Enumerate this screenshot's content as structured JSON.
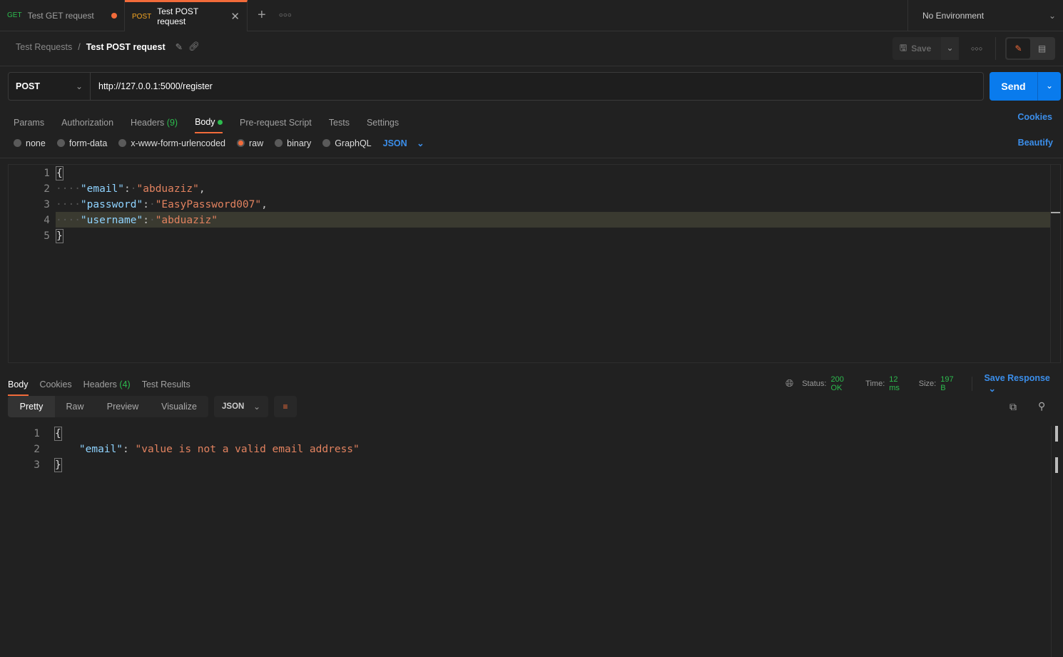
{
  "tabs": [
    {
      "method": "GET",
      "label": "Test GET request",
      "unsaved": true
    },
    {
      "method": "POST",
      "label": "Test POST request",
      "active": true
    }
  ],
  "environment": "No Environment",
  "breadcrumb": {
    "collection": "Test Requests",
    "separator": "/",
    "request": "Test POST request"
  },
  "toolbar": {
    "save": "Save"
  },
  "request": {
    "method": "POST",
    "url": "http://127.0.0.1:5000/register",
    "send": "Send"
  },
  "req_tabs": {
    "params": "Params",
    "auth": "Authorization",
    "headers": "Headers",
    "headers_count": "(9)",
    "body": "Body",
    "prerequest": "Pre-request Script",
    "tests": "Tests",
    "settings": "Settings",
    "cookies": "Cookies"
  },
  "body_types": {
    "none": "none",
    "form_data": "form-data",
    "urlencoded": "x-www-form-urlencoded",
    "raw": "raw",
    "binary": "binary",
    "graphql": "GraphQL",
    "format": "JSON",
    "beautify": "Beautify",
    "selected": "raw"
  },
  "request_body": {
    "line_numbers": [
      "1",
      "2",
      "3",
      "4",
      "5"
    ],
    "open": "{",
    "close": "}",
    "email_key": "\"email\"",
    "email_val": "\"abduaziz\"",
    "password_key": "\"password\"",
    "password_val": "\"EasyPassword007\"",
    "username_key": "\"username\"",
    "username_val": "\"abduaziz\""
  },
  "response": {
    "tabs": {
      "body": "Body",
      "cookies": "Cookies",
      "headers": "Headers",
      "headers_count": "(4)",
      "tests": "Test Results"
    },
    "status_label": "Status:",
    "status": "200 OK",
    "time_label": "Time:",
    "time": "12 ms",
    "size_label": "Size:",
    "size": "197 B",
    "save": "Save Response",
    "views": {
      "pretty": "Pretty",
      "raw": "Raw",
      "preview": "Preview",
      "visualize": "Visualize"
    },
    "format": "JSON",
    "line_numbers": [
      "1",
      "2",
      "3"
    ],
    "open": "{",
    "close": "}",
    "key": "\"email\"",
    "value": "\"value is not a valid email address\""
  },
  "colors": {
    "accent": "#f26b3a",
    "send": "#097bed",
    "link": "#3b8eea",
    "success": "#2dbb4e"
  }
}
